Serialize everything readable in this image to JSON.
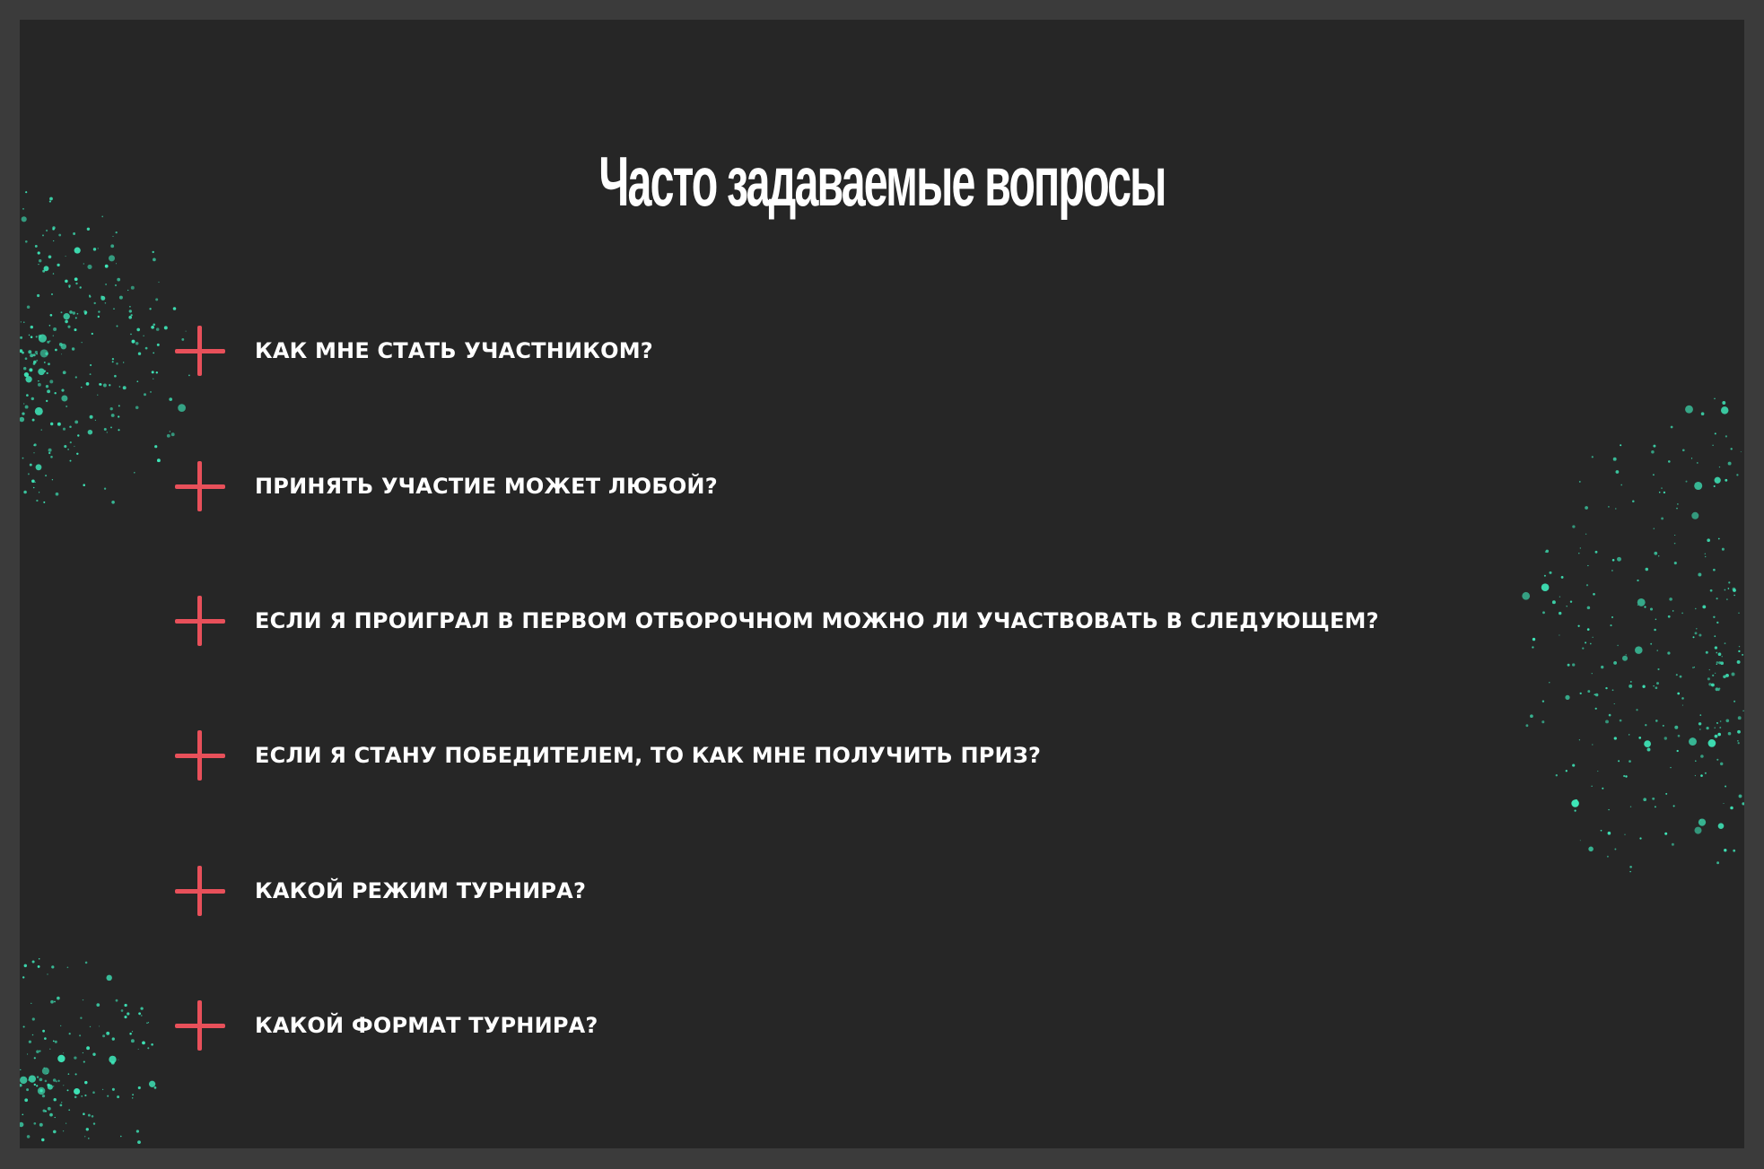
{
  "page": {
    "title": "Часто задаваемые вопросы"
  },
  "faq": {
    "items": [
      {
        "question": "КАК МНЕ СТАТЬ УЧАСТНИКОМ?"
      },
      {
        "question": "ПРИНЯТЬ УЧАСТИЕ МОЖЕТ ЛЮБОЙ?"
      },
      {
        "question": "ЕСЛИ Я ПРОИГРАЛ В ПЕРВОМ ОТБОРОЧНОМ МОЖНО ЛИ УЧАСТВОВАТЬ В СЛЕДУЮЩЕМ?"
      },
      {
        "question": "ЕСЛИ Я СТАНУ ПОБЕДИТЕЛЕМ, ТО КАК МНЕ ПОЛУЧИТЬ ПРИЗ?"
      },
      {
        "question": "КАКОЙ РЕЖИМ ТУРНИРА?"
      },
      {
        "question": "КАКОЙ ФОРМАТ ТУРНИРА?"
      }
    ],
    "expand_icon": "plus-icon"
  },
  "colors": {
    "page_border": "#3b3b3b",
    "panel_background": "#262626",
    "accent_plus": "#e8505a",
    "splatter": "#3ee6b8",
    "text": "#ffffff"
  }
}
